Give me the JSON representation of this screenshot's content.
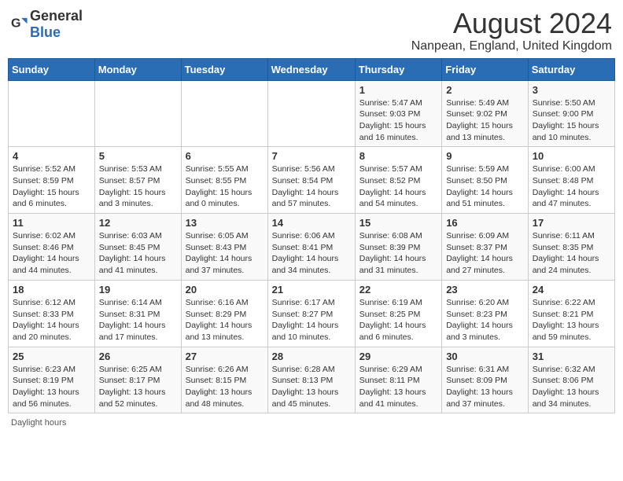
{
  "header": {
    "logo_general": "General",
    "logo_blue": "Blue",
    "month_title": "August 2024",
    "location": "Nanpean, England, United Kingdom"
  },
  "days_of_week": [
    "Sunday",
    "Monday",
    "Tuesday",
    "Wednesday",
    "Thursday",
    "Friday",
    "Saturday"
  ],
  "weeks": [
    [
      {
        "day": "",
        "info": ""
      },
      {
        "day": "",
        "info": ""
      },
      {
        "day": "",
        "info": ""
      },
      {
        "day": "",
        "info": ""
      },
      {
        "day": "1",
        "info": "Sunrise: 5:47 AM\nSunset: 9:03 PM\nDaylight: 15 hours and 16 minutes."
      },
      {
        "day": "2",
        "info": "Sunrise: 5:49 AM\nSunset: 9:02 PM\nDaylight: 15 hours and 13 minutes."
      },
      {
        "day": "3",
        "info": "Sunrise: 5:50 AM\nSunset: 9:00 PM\nDaylight: 15 hours and 10 minutes."
      }
    ],
    [
      {
        "day": "4",
        "info": "Sunrise: 5:52 AM\nSunset: 8:59 PM\nDaylight: 15 hours and 6 minutes."
      },
      {
        "day": "5",
        "info": "Sunrise: 5:53 AM\nSunset: 8:57 PM\nDaylight: 15 hours and 3 minutes."
      },
      {
        "day": "6",
        "info": "Sunrise: 5:55 AM\nSunset: 8:55 PM\nDaylight: 15 hours and 0 minutes."
      },
      {
        "day": "7",
        "info": "Sunrise: 5:56 AM\nSunset: 8:54 PM\nDaylight: 14 hours and 57 minutes."
      },
      {
        "day": "8",
        "info": "Sunrise: 5:57 AM\nSunset: 8:52 PM\nDaylight: 14 hours and 54 minutes."
      },
      {
        "day": "9",
        "info": "Sunrise: 5:59 AM\nSunset: 8:50 PM\nDaylight: 14 hours and 51 minutes."
      },
      {
        "day": "10",
        "info": "Sunrise: 6:00 AM\nSunset: 8:48 PM\nDaylight: 14 hours and 47 minutes."
      }
    ],
    [
      {
        "day": "11",
        "info": "Sunrise: 6:02 AM\nSunset: 8:46 PM\nDaylight: 14 hours and 44 minutes."
      },
      {
        "day": "12",
        "info": "Sunrise: 6:03 AM\nSunset: 8:45 PM\nDaylight: 14 hours and 41 minutes."
      },
      {
        "day": "13",
        "info": "Sunrise: 6:05 AM\nSunset: 8:43 PM\nDaylight: 14 hours and 37 minutes."
      },
      {
        "day": "14",
        "info": "Sunrise: 6:06 AM\nSunset: 8:41 PM\nDaylight: 14 hours and 34 minutes."
      },
      {
        "day": "15",
        "info": "Sunrise: 6:08 AM\nSunset: 8:39 PM\nDaylight: 14 hours and 31 minutes."
      },
      {
        "day": "16",
        "info": "Sunrise: 6:09 AM\nSunset: 8:37 PM\nDaylight: 14 hours and 27 minutes."
      },
      {
        "day": "17",
        "info": "Sunrise: 6:11 AM\nSunset: 8:35 PM\nDaylight: 14 hours and 24 minutes."
      }
    ],
    [
      {
        "day": "18",
        "info": "Sunrise: 6:12 AM\nSunset: 8:33 PM\nDaylight: 14 hours and 20 minutes."
      },
      {
        "day": "19",
        "info": "Sunrise: 6:14 AM\nSunset: 8:31 PM\nDaylight: 14 hours and 17 minutes."
      },
      {
        "day": "20",
        "info": "Sunrise: 6:16 AM\nSunset: 8:29 PM\nDaylight: 14 hours and 13 minutes."
      },
      {
        "day": "21",
        "info": "Sunrise: 6:17 AM\nSunset: 8:27 PM\nDaylight: 14 hours and 10 minutes."
      },
      {
        "day": "22",
        "info": "Sunrise: 6:19 AM\nSunset: 8:25 PM\nDaylight: 14 hours and 6 minutes."
      },
      {
        "day": "23",
        "info": "Sunrise: 6:20 AM\nSunset: 8:23 PM\nDaylight: 14 hours and 3 minutes."
      },
      {
        "day": "24",
        "info": "Sunrise: 6:22 AM\nSunset: 8:21 PM\nDaylight: 13 hours and 59 minutes."
      }
    ],
    [
      {
        "day": "25",
        "info": "Sunrise: 6:23 AM\nSunset: 8:19 PM\nDaylight: 13 hours and 56 minutes."
      },
      {
        "day": "26",
        "info": "Sunrise: 6:25 AM\nSunset: 8:17 PM\nDaylight: 13 hours and 52 minutes."
      },
      {
        "day": "27",
        "info": "Sunrise: 6:26 AM\nSunset: 8:15 PM\nDaylight: 13 hours and 48 minutes."
      },
      {
        "day": "28",
        "info": "Sunrise: 6:28 AM\nSunset: 8:13 PM\nDaylight: 13 hours and 45 minutes."
      },
      {
        "day": "29",
        "info": "Sunrise: 6:29 AM\nSunset: 8:11 PM\nDaylight: 13 hours and 41 minutes."
      },
      {
        "day": "30",
        "info": "Sunrise: 6:31 AM\nSunset: 8:09 PM\nDaylight: 13 hours and 37 minutes."
      },
      {
        "day": "31",
        "info": "Sunrise: 6:32 AM\nSunset: 8:06 PM\nDaylight: 13 hours and 34 minutes."
      }
    ]
  ],
  "footer": {
    "daylight_label": "Daylight hours"
  }
}
